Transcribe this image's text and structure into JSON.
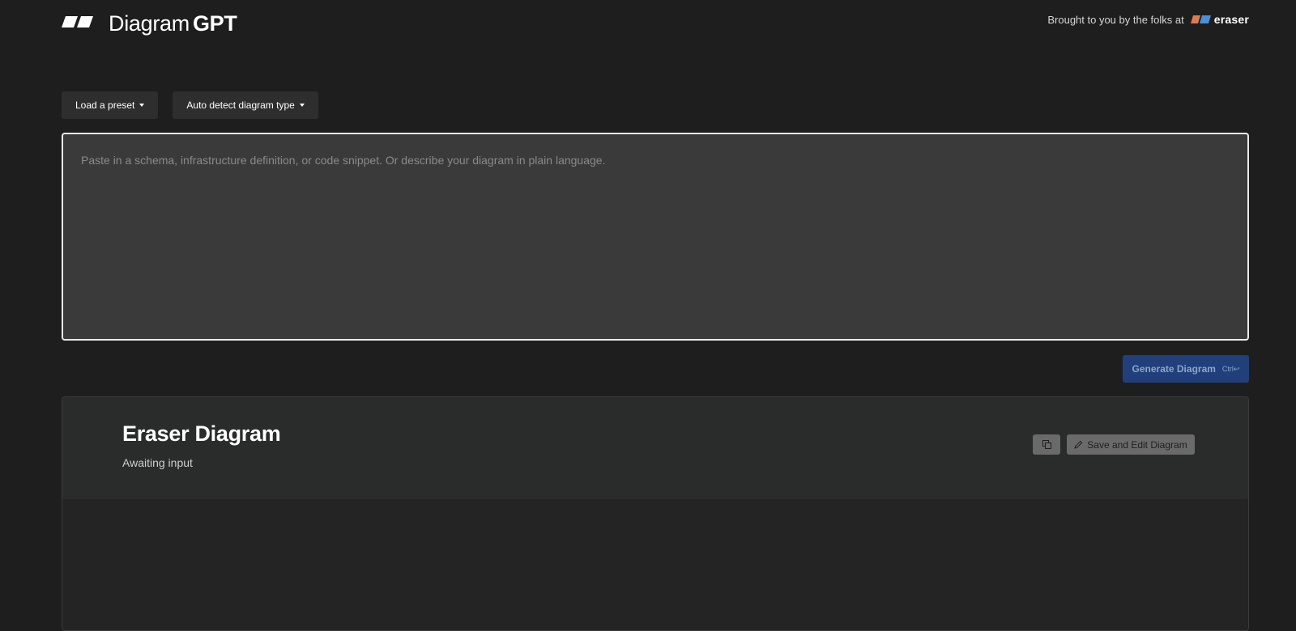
{
  "header": {
    "logo_light": "Diagram",
    "logo_bold": "GPT",
    "brought_by": "Brought to you by the folks at",
    "eraser_word": "eraser"
  },
  "toolbar": {
    "preset_label": "Load a preset",
    "diagram_type_label": "Auto detect diagram type"
  },
  "input": {
    "placeholder": "Paste in a schema, infrastructure definition, or code snippet. Or describe your diagram in plain language.",
    "value": ""
  },
  "generate": {
    "label": "Generate Diagram",
    "shortcut": "Ctrl↩"
  },
  "result": {
    "title": "Eraser Diagram",
    "status": "Awaiting input",
    "save_label": "Save and Edit Diagram"
  },
  "icons": {
    "logo": "diagramgpt-logo-icon",
    "eraser": "eraser-logo-icon",
    "copy": "copy-icon",
    "pencil": "pencil-icon",
    "caret": "caret-down-icon"
  },
  "colors": {
    "background": "#1e1e1e",
    "input_bg": "#3a3a3a",
    "generate_bg": "#213f7a",
    "eraser_orange": "#e07a4f",
    "eraser_blue": "#4a8fd8"
  }
}
